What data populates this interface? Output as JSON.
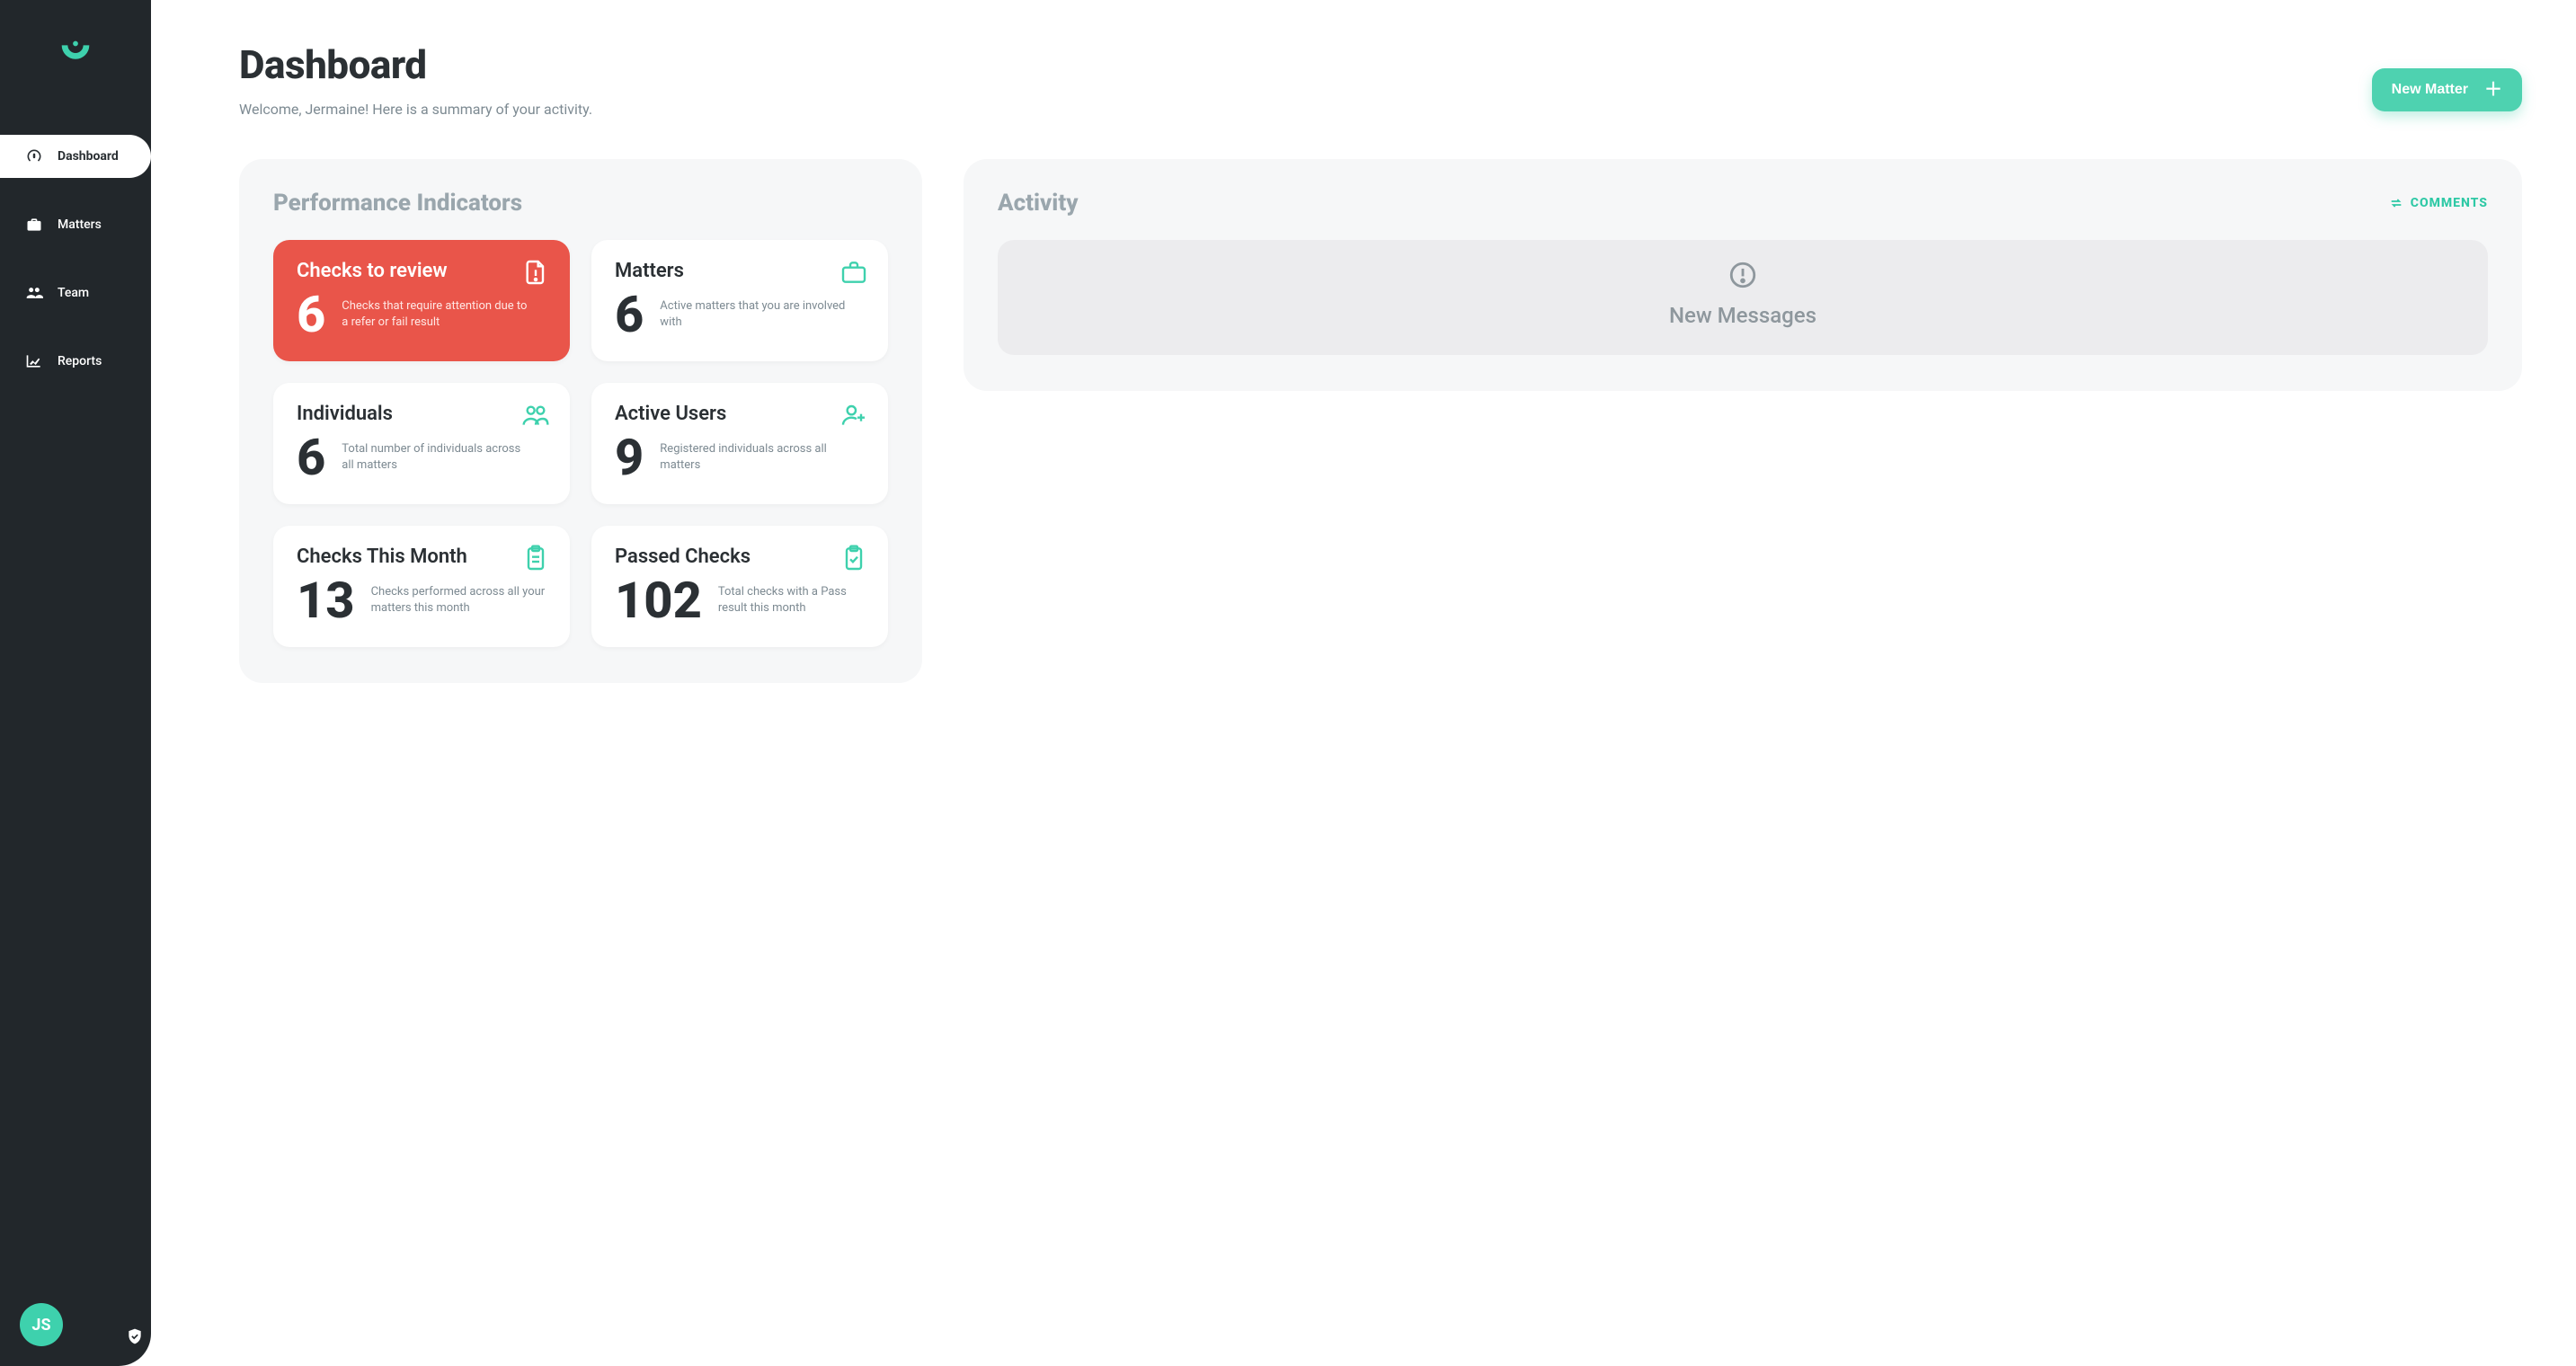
{
  "sidebar": {
    "items": [
      {
        "label": "Dashboard"
      },
      {
        "label": "Matters"
      },
      {
        "label": "Team"
      },
      {
        "label": "Reports"
      }
    ],
    "avatar_initials": "JS"
  },
  "header": {
    "title": "Dashboard",
    "welcome": "Welcome, Jermaine! Here is a summary of your activity.",
    "new_matter_label": "New Matter"
  },
  "kpi": {
    "section_title": "Performance Indicators",
    "cards": [
      {
        "title": "Checks to review",
        "value": "6",
        "desc": "Checks that require attention due to a refer or fail result"
      },
      {
        "title": "Matters",
        "value": "6",
        "desc": "Active matters that you are involved with"
      },
      {
        "title": "Individuals",
        "value": "6",
        "desc": "Total number of individuals across all matters"
      },
      {
        "title": "Active Users",
        "value": "9",
        "desc": "Registered individuals across all matters"
      },
      {
        "title": "Checks This Month",
        "value": "13",
        "desc": "Checks performed across all your matters this month"
      },
      {
        "title": "Passed Checks",
        "value": "102",
        "desc": "Total checks with a Pass result this month"
      }
    ]
  },
  "activity": {
    "title": "Activity",
    "comments_label": "COMMENTS",
    "empty_message": "New Messages"
  }
}
